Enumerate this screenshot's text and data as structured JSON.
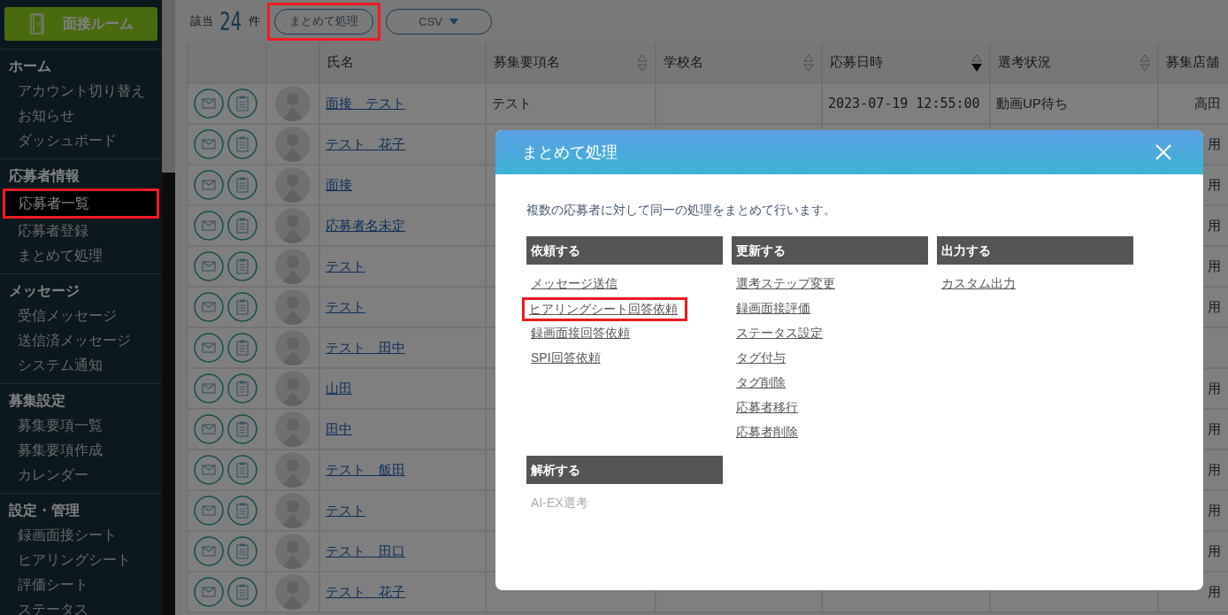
{
  "sidebar": {
    "room_button": {
      "label": "面接ルーム"
    },
    "sections": [
      {
        "title": "ホーム",
        "items": [
          {
            "label": "アカウント切り替え",
            "selected": false,
            "highlighted": false
          },
          {
            "label": "お知らせ",
            "selected": false,
            "highlighted": false
          },
          {
            "label": "ダッシュボード",
            "selected": false,
            "highlighted": false
          }
        ]
      },
      {
        "title": "応募者情報",
        "items": [
          {
            "label": "応募者一覧",
            "selected": true,
            "highlighted": true
          },
          {
            "label": "応募者登録",
            "selected": false,
            "highlighted": false
          },
          {
            "label": "まとめて処理",
            "selected": false,
            "highlighted": false
          }
        ]
      },
      {
        "title": "メッセージ",
        "items": [
          {
            "label": "受信メッセージ",
            "selected": false,
            "highlighted": false
          },
          {
            "label": "送信済メッセージ",
            "selected": false,
            "highlighted": false
          },
          {
            "label": "システム通知",
            "selected": false,
            "highlighted": false
          }
        ]
      },
      {
        "title": "募集設定",
        "items": [
          {
            "label": "募集要項一覧",
            "selected": false,
            "highlighted": false
          },
          {
            "label": "募集要項作成",
            "selected": false,
            "highlighted": false
          },
          {
            "label": "カレンダー",
            "selected": false,
            "highlighted": false
          }
        ]
      },
      {
        "title": "設定・管理",
        "items": [
          {
            "label": "録画面接シート",
            "selected": false,
            "highlighted": false
          },
          {
            "label": "ヒアリングシート",
            "selected": false,
            "highlighted": false
          },
          {
            "label": "評価シート",
            "selected": false,
            "highlighted": false
          },
          {
            "label": "ステータス",
            "selected": false,
            "highlighted": false
          }
        ]
      }
    ]
  },
  "toolbar": {
    "count_label": "該当",
    "count": "24",
    "count_unit": "件",
    "buttons": [
      {
        "label": "まとめて処理",
        "kind": "plain",
        "highlighted": true
      },
      {
        "label": "CSV",
        "kind": "dropdown",
        "highlighted": false
      }
    ]
  },
  "table": {
    "columns": [
      {
        "label": "氏名",
        "sortable": false
      },
      {
        "label": "募集要項名",
        "sortable": true,
        "sorted_desc": false
      },
      {
        "label": "学校名",
        "sortable": true,
        "sorted_desc": false
      },
      {
        "label": "応募日時",
        "sortable": true,
        "sorted_desc": true
      },
      {
        "label": "選考状況",
        "sortable": true,
        "sorted_desc": false
      },
      {
        "label": "募集店舗",
        "sortable": false
      }
    ],
    "rows": [
      {
        "name": "面接　テスト",
        "posting": "テスト",
        "applied_at": "2023-07-19 12:55:00",
        "status": "動画UP待ち",
        "store": "高田"
      },
      {
        "name": "テスト　花子",
        "store": "用"
      },
      {
        "name": "面接",
        "store": "用"
      },
      {
        "name": "応募者名未定",
        "store": "用"
      },
      {
        "name": "テスト",
        "store": "用"
      },
      {
        "name": "テスト",
        "store": "用"
      },
      {
        "name": "テスト　田中"
      },
      {
        "name": "山田",
        "store": "用"
      },
      {
        "name": "田中",
        "store": "用"
      },
      {
        "name": "テスト　飯田",
        "store": "用"
      },
      {
        "name": "テスト",
        "store": "用"
      },
      {
        "name": "テスト　田口",
        "store": "用"
      },
      {
        "name": "テスト　花子",
        "store": "用"
      }
    ]
  },
  "modal": {
    "title": "まとめて処理",
    "description": "複数の応募者に対して同一の処理をまとめて行います。",
    "groups": [
      {
        "title": "依頼する",
        "items": [
          {
            "label": "メッセージ送信",
            "disabled": false,
            "highlighted": false
          },
          {
            "label": "ヒアリングシート回答依頼",
            "disabled": false,
            "highlighted": true
          },
          {
            "label": "録画面接回答依頼",
            "disabled": false,
            "highlighted": false
          },
          {
            "label": "SPI回答依頼",
            "disabled": false,
            "highlighted": false
          }
        ]
      },
      {
        "title": "更新する",
        "items": [
          {
            "label": "選考ステップ変更",
            "disabled": false,
            "highlighted": false
          },
          {
            "label": "録画面接評価",
            "disabled": false,
            "highlighted": false
          },
          {
            "label": "ステータス設定",
            "disabled": false,
            "highlighted": false
          },
          {
            "label": "タグ付与",
            "disabled": false,
            "highlighted": false
          },
          {
            "label": "タグ削除",
            "disabled": false,
            "highlighted": false
          },
          {
            "label": "応募者移行",
            "disabled": false,
            "highlighted": false
          },
          {
            "label": "応募者削除",
            "disabled": false,
            "highlighted": false
          }
        ]
      },
      {
        "title": "出力する",
        "items": [
          {
            "label": "カスタム出力",
            "disabled": false,
            "highlighted": false
          }
        ]
      },
      {
        "title": "解析する",
        "items": [
          {
            "label": "AI-EX選考",
            "disabled": true,
            "highlighted": false
          }
        ]
      }
    ]
  }
}
